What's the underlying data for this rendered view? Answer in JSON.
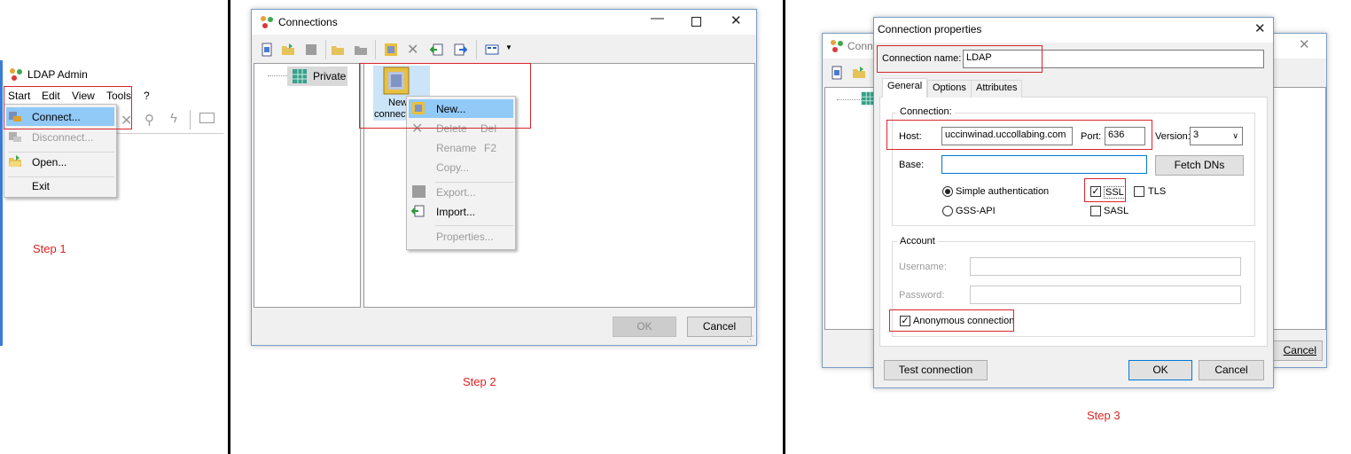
{
  "step1": {
    "app_title": "LDAP Admin",
    "menubar": [
      "Start",
      "Edit",
      "View",
      "Tools",
      "?"
    ],
    "menu_items": [
      "Connect...",
      "Disconnect...",
      "Open...",
      "Exit"
    ],
    "label": "Step 1"
  },
  "step2": {
    "title": "Connections",
    "tree_item": "Private",
    "item_label_1": "New",
    "item_label_2": "connect",
    "context_menu": {
      "new": "New...",
      "delete": "Delete",
      "delete_shortcut": "Del",
      "rename": "Rename",
      "rename_shortcut": "F2",
      "copy": "Copy...",
      "export": "Export...",
      "import": "Import...",
      "properties": "Properties..."
    },
    "ok": "OK",
    "cancel": "Cancel",
    "label": "Step 2"
  },
  "step3": {
    "bg_title": "Conn",
    "bg_cancel": "Cancel",
    "title": "Connection properties",
    "conn_name_label": "Connection name:",
    "conn_name_value": "LDAP",
    "tabs": [
      "General",
      "Options",
      "Attributes"
    ],
    "connection_group": "Connection:",
    "host_label": "Host:",
    "host_value": "uccinwinad.uccollabing.com",
    "port_label": "Port:",
    "port_value": "636",
    "version_label": "Version:",
    "version_value": "3",
    "base_label": "Base:",
    "base_value": "",
    "fetch_dns": "Fetch DNs",
    "simple_auth": "Simple authentication",
    "gss_api": "GSS-API",
    "ssl": "SSL",
    "tls": "TLS",
    "sasl": "SASL",
    "account_group": "Account",
    "username_label": "Username:",
    "password_label": "Password:",
    "anonymous": "Anonymous connection",
    "test_connection": "Test connection",
    "ok": "OK",
    "cancel": "Cancel",
    "label": "Step 3"
  },
  "colors": {
    "highlight_red": "#d9262c",
    "step_label": "#dd2222",
    "menu_selection": "#91c9f7"
  }
}
